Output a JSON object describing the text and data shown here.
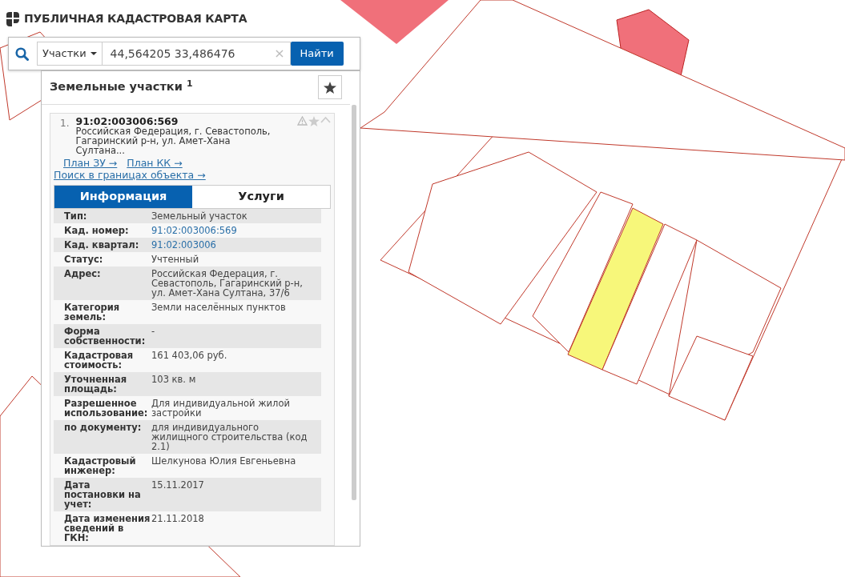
{
  "header": {
    "title": "ПУБЛИЧНАЯ КАДАСТРОВАЯ КАРТА"
  },
  "search": {
    "type_select": "Участки",
    "value": "44,564205 33,486476",
    "clear": "×",
    "submit": "Найти"
  },
  "results": {
    "title": "Земельные участки $^{1}$"
  },
  "result": {
    "index": "1.",
    "number": "91:02:003006:569",
    "address": "Российская Федерация, г. Севастополь, Гагаринский р-н, ул. Амет-Хана Султана...",
    "links": [
      "План ЗУ →",
      "План КК →",
      "Поиск в границах объекта →"
    ],
    "tabs": [
      {
        "label": "Информация",
        "selected": true
      },
      {
        "label": "Услуги",
        "selected": false
      }
    ],
    "fields": [
      {
        "label": "Тип:",
        "value": "Земельный участок",
        "kind": "text"
      },
      {
        "label": "Кад. номер:",
        "value": "91:02:003006:569",
        "kind": "link"
      },
      {
        "label": "Кад. квартал:",
        "value": "91:02:003006",
        "kind": "link"
      },
      {
        "label": "Статус:",
        "value": "Учтенный",
        "kind": "text"
      },
      {
        "label": "Адрес:",
        "value": "Российская Федерация, г. Севастополь, Гагаринский р-н, ул. Амет-Хана Султана, 37/6",
        "kind": "text"
      },
      {
        "label": "Категория земель:",
        "value": "Земли населённых пунктов",
        "kind": "text"
      },
      {
        "label": "Форма собственности:",
        "value": "-",
        "kind": "text"
      },
      {
        "label": "Кадастровая стоимость:",
        "value": "161 403,06 руб.",
        "kind": "text"
      },
      {
        "label": "Уточненная площадь:",
        "value": "103 кв. м",
        "kind": "text"
      },
      {
        "label": "Разрешенное использование:",
        "value": "Для индивидуальной жилой застройки",
        "kind": "text"
      },
      {
        "label": "по документу:",
        "value": "для индивидуального жилищного строительства (код 2.1)",
        "kind": "text"
      },
      {
        "label": "Кадастровый инженер:",
        "value": "Шелкунова Юлия Евгеньевна",
        "kind": "text"
      },
      {
        "label": "Дата постановки на учет:",
        "value": "15.11.2017",
        "kind": "text"
      },
      {
        "label": "Дата изменения сведений в ГКН:",
        "value": "21.11.2018",
        "kind": "text"
      }
    ]
  }
}
